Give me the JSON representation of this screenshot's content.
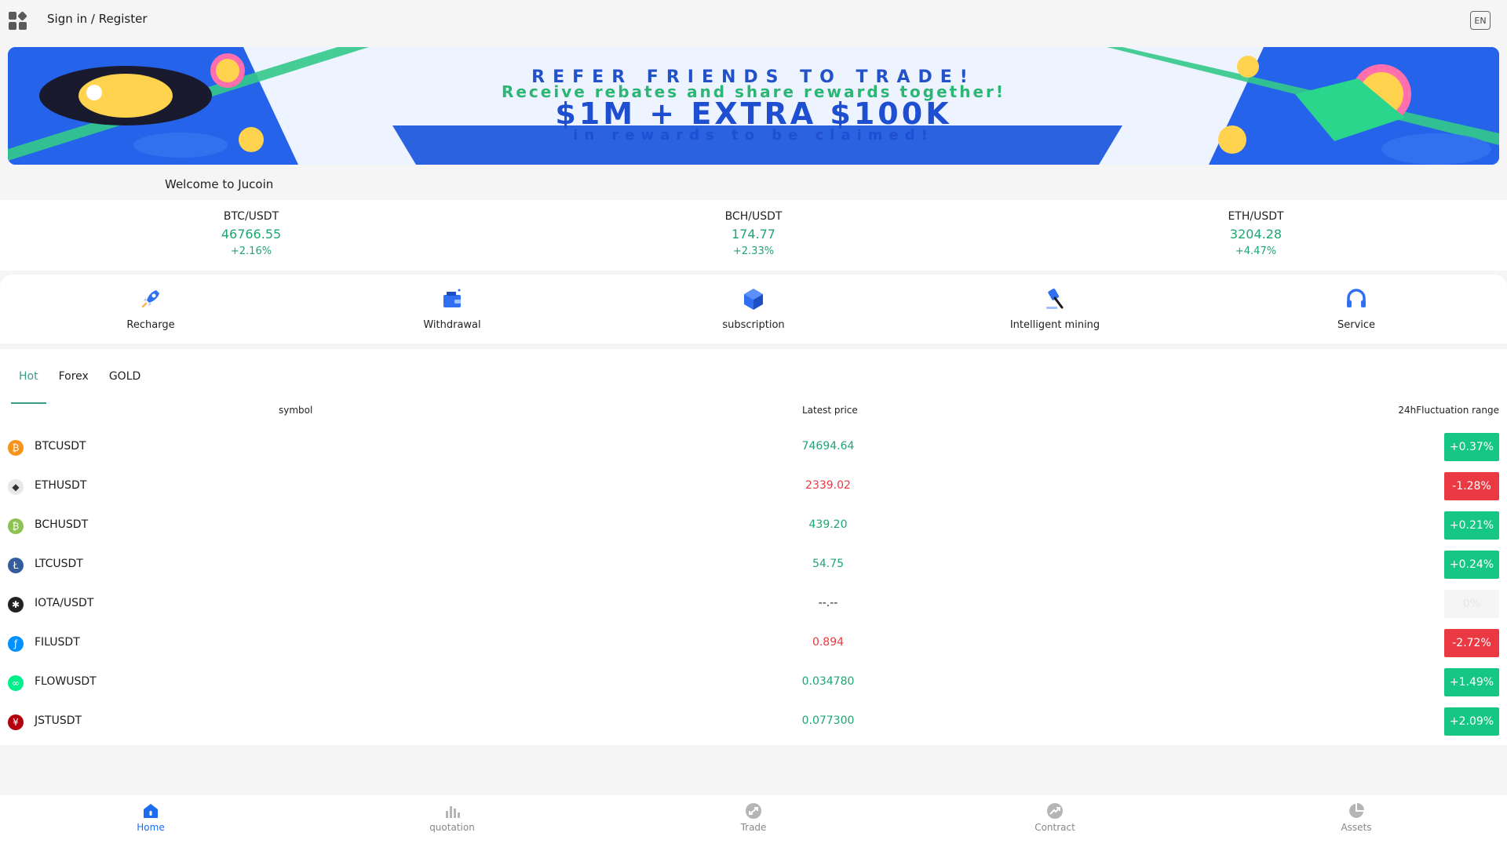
{
  "header": {
    "signin_label": "Sign in / Register",
    "lang_label": "EN",
    "apps_icon": "grid-apps-icon"
  },
  "banner": {
    "line1": "REFER FRIENDS TO TRADE!",
    "line2": "Receive rebates and share rewards together!",
    "line3": "$1M + EXTRA $100K",
    "line4": "in rewards to be claimed!"
  },
  "welcome": "Welcome to Jucoin",
  "tickers": [
    {
      "pair": "BTC/USDT",
      "price": "46766.55",
      "change": "+2.16%"
    },
    {
      "pair": "BCH/USDT",
      "price": "174.77",
      "change": "+2.33%"
    },
    {
      "pair": "ETH/USDT",
      "price": "3204.28",
      "change": "+4.47%"
    }
  ],
  "shortcuts": [
    {
      "label": "Recharge",
      "icon": "rocket-icon"
    },
    {
      "label": "Withdrawal",
      "icon": "wallet-icon"
    },
    {
      "label": "subscription",
      "icon": "cube-icon"
    },
    {
      "label": "Intelligent mining",
      "icon": "hammer-icon"
    },
    {
      "label": "Service",
      "icon": "headset-icon"
    }
  ],
  "market": {
    "tabs": [
      "Hot",
      "Forex",
      "GOLD"
    ],
    "active_tab": "Hot",
    "columns": {
      "symbol": "symbol",
      "price": "Latest price",
      "range": "24hFluctuation range"
    },
    "rows": [
      {
        "symbol": "BTCUSDT",
        "price": "74694.64",
        "change": "+0.37%",
        "direction": "up",
        "icon_color": "#f7931a",
        "icon": "bitcoin-icon"
      },
      {
        "symbol": "ETHUSDT",
        "price": "2339.02",
        "change": "-1.28%",
        "direction": "down",
        "icon_color": "#e8e8e8",
        "icon": "ethereum-icon"
      },
      {
        "symbol": "BCHUSDT",
        "price": "439.20",
        "change": "+0.21%",
        "direction": "up",
        "icon_color": "#8dc351",
        "icon": "bitcoin-cash-icon"
      },
      {
        "symbol": "LTCUSDT",
        "price": "54.75",
        "change": "+0.24%",
        "direction": "up",
        "icon_color": "#345d9d",
        "icon": "litecoin-icon"
      },
      {
        "symbol": "IOTA/USDT",
        "price": "--.--",
        "change": "0%",
        "direction": "flat",
        "icon_color": "#222222",
        "icon": "iota-icon"
      },
      {
        "symbol": "FILUSDT",
        "price": "0.894",
        "change": "-2.72%",
        "direction": "down",
        "icon_color": "#0090ff",
        "icon": "filecoin-icon"
      },
      {
        "symbol": "FLOWUSDT",
        "price": "0.034780",
        "change": "+1.49%",
        "direction": "up",
        "icon_color": "#00ef8b",
        "icon": "flow-icon"
      },
      {
        "symbol": "JSTUSDT",
        "price": "0.077300",
        "change": "+2.09%",
        "direction": "up",
        "icon_color": "#b3000c",
        "icon": "just-icon"
      }
    ]
  },
  "colors": {
    "up": "#16c784",
    "down": "#ea3943",
    "flat_bg": "#f5f5f5",
    "up_text": "#1ea672",
    "accent": "#1d6cf2"
  },
  "bottom_nav": [
    {
      "label": "Home",
      "icon": "home-icon",
      "active": true
    },
    {
      "label": "quotation",
      "icon": "bar-chart-icon",
      "active": false
    },
    {
      "label": "Trade",
      "icon": "trade-icon",
      "active": false
    },
    {
      "label": "Contract",
      "icon": "contract-icon",
      "active": false
    },
    {
      "label": "Assets",
      "icon": "pie-chart-icon",
      "active": false
    }
  ]
}
